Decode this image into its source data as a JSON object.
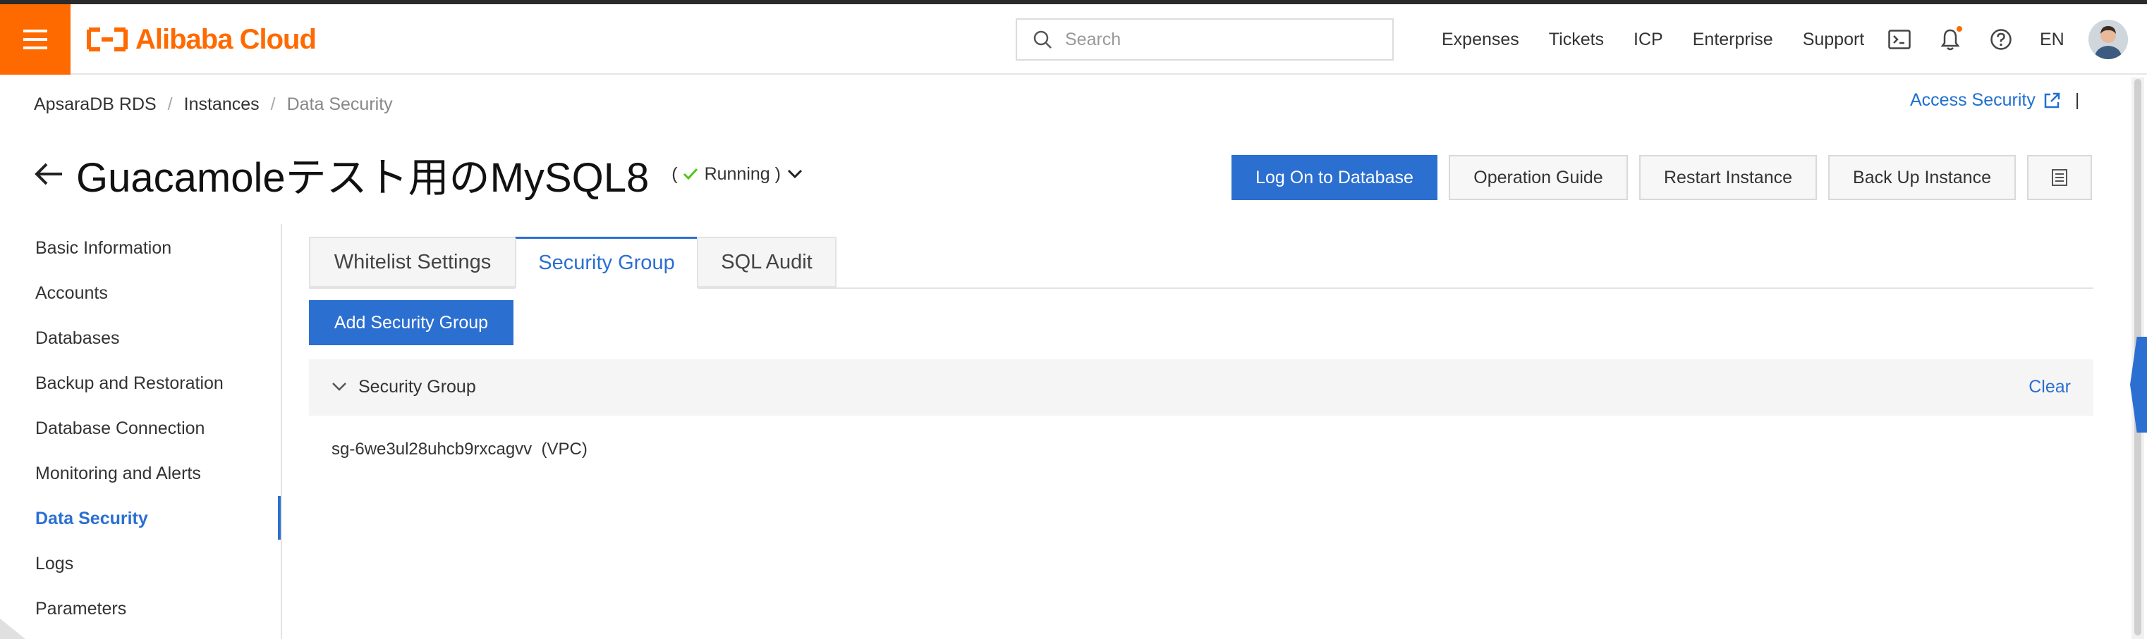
{
  "topbar": {
    "logo_text": "Alibaba Cloud",
    "search_placeholder": "Search",
    "links": [
      "Expenses",
      "Tickets",
      "ICP",
      "Enterprise",
      "Support"
    ],
    "language": "EN"
  },
  "breadcrumb": {
    "items": [
      "ApsaraDB RDS",
      "Instances",
      "Data Security"
    ],
    "separator": "/"
  },
  "access_security": {
    "label": "Access Security",
    "divider": "|"
  },
  "title": {
    "instance_name": "Guacamoleテスト用のMySQL8",
    "status_open": "(",
    "status": "Running )"
  },
  "actions": {
    "log_on": "Log On to Database",
    "operation_guide": "Operation Guide",
    "restart": "Restart Instance",
    "backup": "Back Up Instance"
  },
  "leftnav": {
    "items": [
      "Basic Information",
      "Accounts",
      "Databases",
      "Backup and Restoration",
      "Database Connection",
      "Monitoring and Alerts",
      "Data Security",
      "Logs",
      "Parameters"
    ],
    "active": "Data Security"
  },
  "tabs": {
    "items": [
      "Whitelist Settings",
      "Security Group",
      "SQL Audit"
    ],
    "active": "Security Group"
  },
  "content": {
    "add_button": "Add Security Group",
    "panel_title": "Security Group",
    "clear_label": "Clear",
    "security_group_entry": "sg-6we3ul28uhcb9rxcagvv  (VPC)"
  },
  "colors": {
    "brand": "#ff6a00",
    "primary": "#2b6fd1",
    "status_ok": "#52c41a"
  }
}
